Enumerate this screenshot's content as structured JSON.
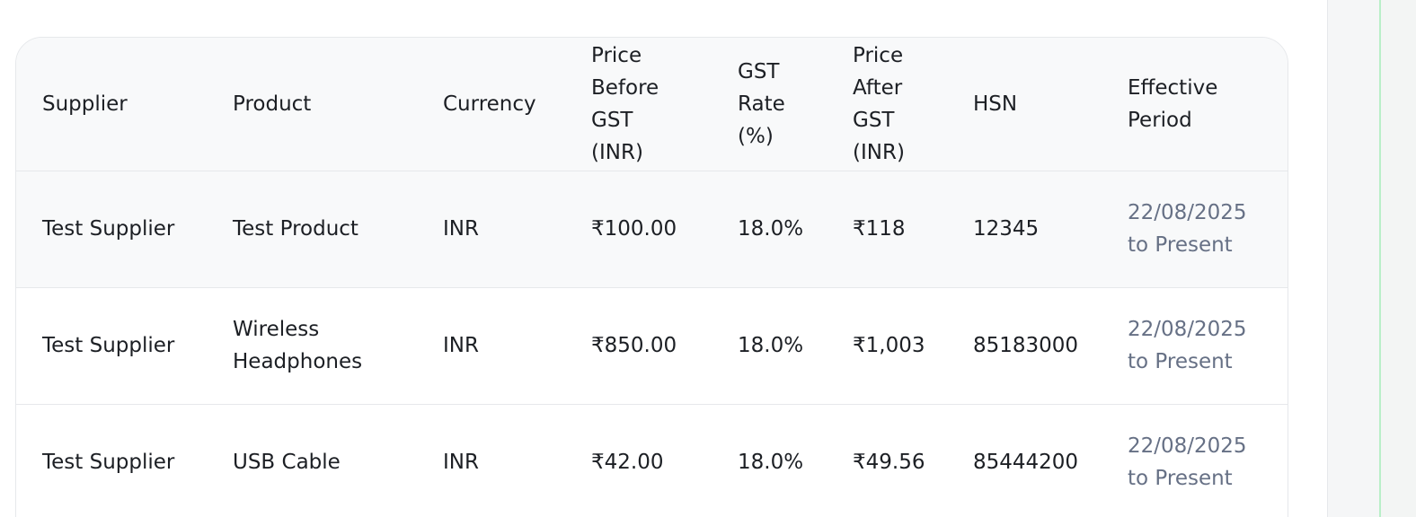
{
  "table": {
    "headers": [
      "Supplier",
      "Product",
      "Currency",
      "Price Before GST (INR)",
      "GST Rate (%)",
      "Price After GST (INR)",
      "HSN",
      "Effective Period"
    ],
    "rows": [
      {
        "supplier": "Test Supplier",
        "product": "Test Product",
        "currency": "INR",
        "price_before": "₹100.00",
        "gst_rate": "18.0%",
        "price_after": "₹118",
        "hsn": "12345",
        "period": "22/08/2025 to Present"
      },
      {
        "supplier": "Test Supplier",
        "product": "Wireless Headphones",
        "currency": "INR",
        "price_before": "₹850.00",
        "gst_rate": "18.0%",
        "price_after": "₹1,003",
        "hsn": "85183000",
        "period": "22/08/2025 to Present"
      },
      {
        "supplier": "Test Supplier",
        "product": "USB Cable",
        "currency": "INR",
        "price_before": "₹42.00",
        "gst_rate": "18.0%",
        "price_after": "₹49.56",
        "hsn": "85444200",
        "period": "22/08/2025 to Present"
      }
    ]
  },
  "colors": {
    "header_bg": "#f8f9fa",
    "border": "#e6e8eb",
    "muted_text": "#667085",
    "accent_line": "#b9efc8"
  }
}
